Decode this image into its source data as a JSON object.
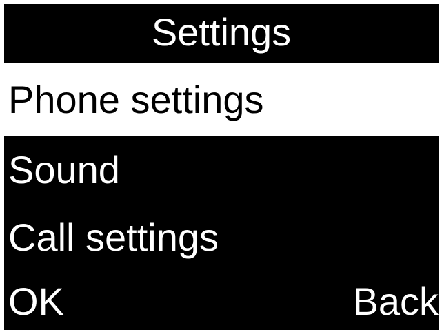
{
  "screen": {
    "title": "Settings",
    "colors": {
      "background": "#000000",
      "text": "#ffffff",
      "selected_background": "#ffffff",
      "selected_text": "#000000"
    }
  },
  "menu": {
    "selected_index": 0,
    "items": [
      {
        "label": "Phone settings"
      },
      {
        "label": "Sound"
      },
      {
        "label": "Call settings"
      }
    ]
  },
  "softkeys": {
    "left_label": "OK",
    "right_label": "Back"
  }
}
